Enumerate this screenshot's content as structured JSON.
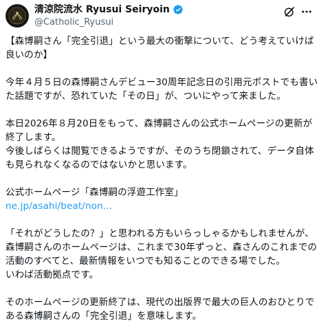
{
  "author": {
    "display_name": "清涼院流水 Ryusui Seiryoin",
    "handle": "@Catholic_Ryusui",
    "verified": true,
    "accent_color": "#1d9bf0"
  },
  "icons": {
    "avatar": "avatar-image",
    "verified": "verified-badge-icon",
    "grok": "grok-icon",
    "more": "more-options-icon"
  },
  "tweet": {
    "lines": [
      "【森博嗣さん「完全引退」という最大の衝撃について、どう考えていけば",
      "良いのか】",
      "",
      "今年４月５日の森博嗣さんデビュー30周年記念日の引用元ポストでも書い",
      "た話題ですが、恐れていた「その日」が、ついにやって来ました。",
      "",
      "本日2026年８月20日をもって、森博嗣さんの公式ホームページの更新が",
      "終了します。",
      "今後しばらくは閲覧できるようですが、そのうち閉鎖されて、データ自体",
      "も見られなくなるのではないかと思います。",
      "",
      "公式ホームページ「森博嗣の浮遊工作室」",
      "",
      "",
      "「それがどうしたの？」と思われる方もいらっしゃるかもしれませんが、",
      "森博嗣さんのホームページは、これまで30年ずっと、森さんのこれまでの",
      "活動のすべてと、最新情報をいつでも知ることのできる場でした。",
      "いわば活動拠点です。",
      "",
      "そのホームページの更新終了は、現代の出版界で最大の巨人のおひとりで",
      "ある森博嗣さんの「完全引退」を意味します。"
    ],
    "link_text": "ne.jp/asahi/beat/non..."
  }
}
